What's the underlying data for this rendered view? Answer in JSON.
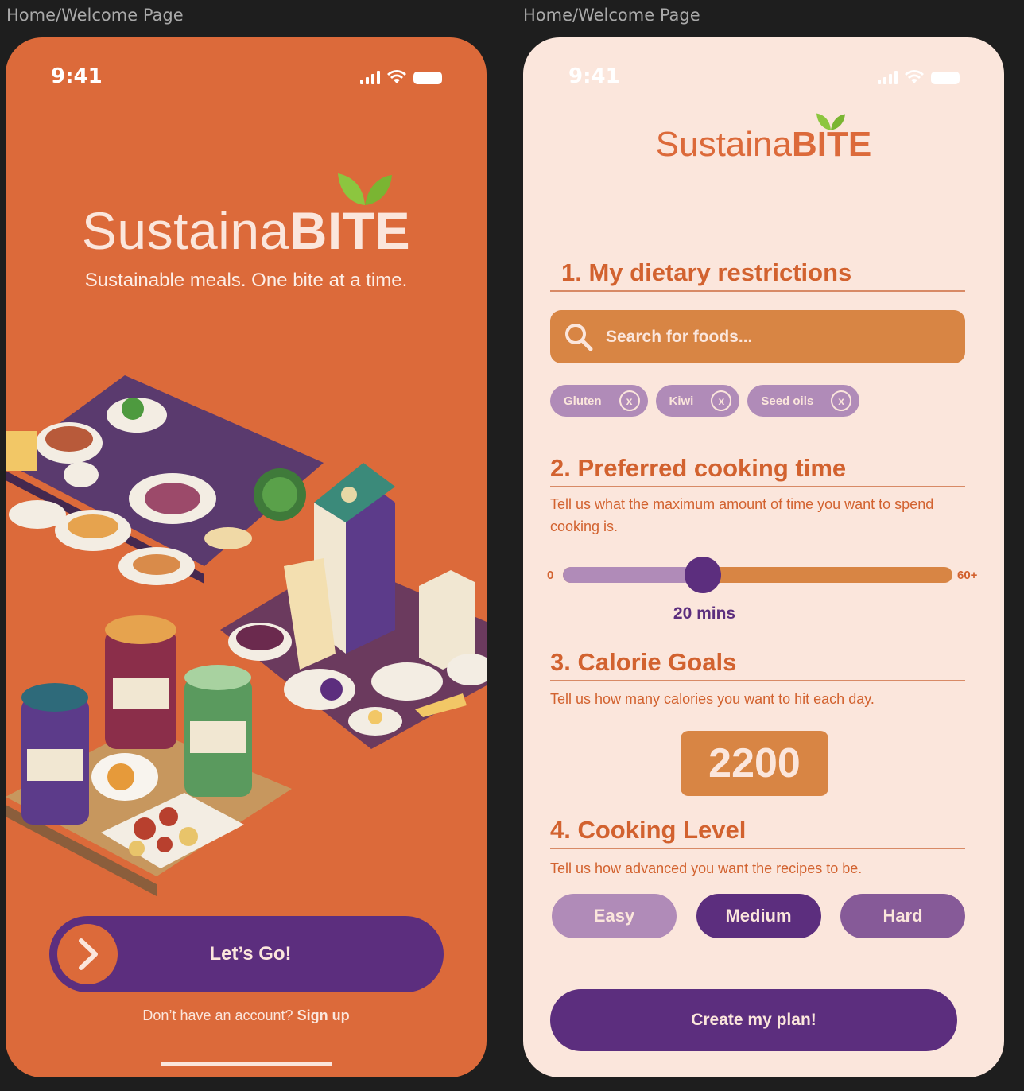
{
  "frames": [
    {
      "label": "Home/Welcome Page"
    },
    {
      "label": "Home/Welcome Page"
    }
  ],
  "colors": {
    "orange": "#dc6a3a",
    "orange_light": "#d88544",
    "cream": "#fbe6dc",
    "purple": "#5c2e7e",
    "lavender": "#b08bb8",
    "leaf_green": "#8cc63f"
  },
  "welcome": {
    "time": "9:41",
    "brand_light": "Sustaina",
    "brand_bold": "BITE",
    "tagline": "Sustainable meals. One bite at a time.",
    "go_button": "Let’s Go!",
    "signup_prompt": "Don’t have an account?",
    "signup_link": "Sign up",
    "illustration": "isometric-food-illustration"
  },
  "onboarding": {
    "time": "9:41",
    "brand_light": "Sustaina",
    "brand_bold": "BITE",
    "section1": {
      "title": "1. My dietary restrictions",
      "search_placeholder": "Search for foods...",
      "chips": [
        {
          "label": "Gluten",
          "remove": "x"
        },
        {
          "label": "Kiwi",
          "remove": "x"
        },
        {
          "label": "Seed oils",
          "remove": "x"
        }
      ]
    },
    "section2": {
      "title": "2. Preferred cooking time",
      "description": "Tell us what the maximum amount of time you want to spend cooking is.",
      "slider_min": "0",
      "slider_max": "60+",
      "slider_value_label": "20 mins",
      "slider_fraction": 0.36
    },
    "section3": {
      "title": "3. Calorie Goals",
      "description": "Tell us how many calories you want to hit each day.",
      "calories": "2200"
    },
    "section4": {
      "title": "4. Cooking Level",
      "description": "Tell us how advanced you want the recipes to be.",
      "levels": [
        {
          "label": "Easy",
          "selected": false
        },
        {
          "label": "Medium",
          "selected": true
        },
        {
          "label": "Hard",
          "selected": false
        }
      ]
    },
    "create_button": "Create my plan!"
  }
}
